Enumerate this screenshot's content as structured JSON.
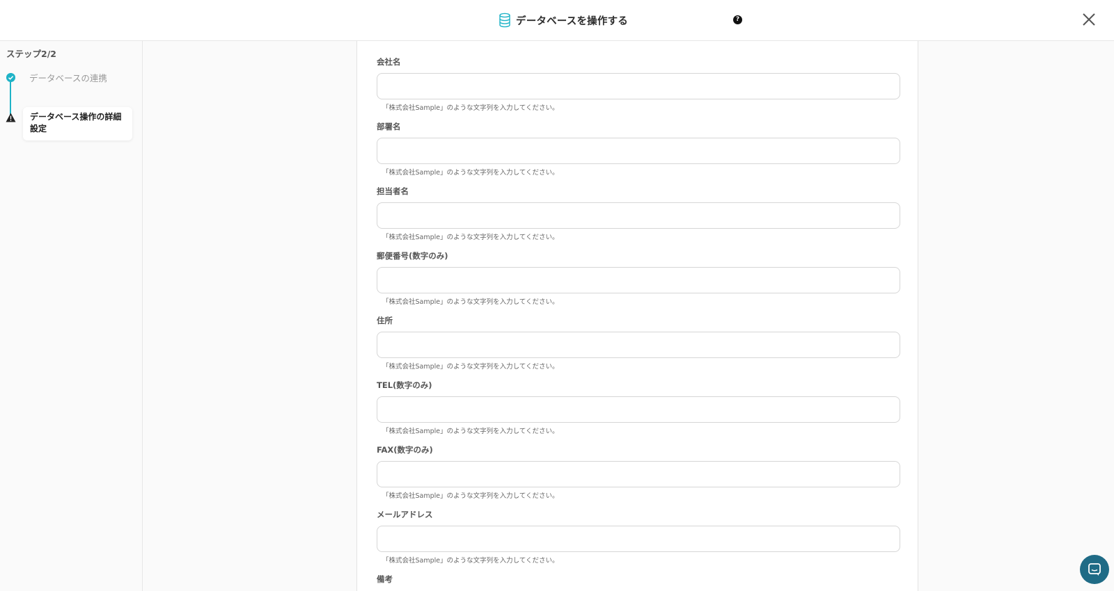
{
  "header": {
    "title": "データベースを操作する",
    "help_icon": "question-circle-icon",
    "close_icon": "close-icon"
  },
  "sidebar": {
    "step_count": "ステップ2/2",
    "steps": [
      {
        "label": "データベースの連携",
        "status": "done",
        "icon": "check-circle-icon"
      },
      {
        "label": "データベース操作の詳細設定",
        "status": "warning",
        "icon": "warning-icon"
      }
    ]
  },
  "form": {
    "fields": [
      {
        "label": "会社名",
        "value": "",
        "hint": "「株式会社Sample」のような文字列を入力してください。"
      },
      {
        "label": "部署名",
        "value": "",
        "hint": "「株式会社Sample」のような文字列を入力してください。"
      },
      {
        "label": "担当者名",
        "value": "",
        "hint": "「株式会社Sample」のような文字列を入力してください。"
      },
      {
        "label": "郵便番号(数字のみ)",
        "value": "",
        "hint": "「株式会社Sample」のような文字列を入力してください。"
      },
      {
        "label": "住所",
        "value": "",
        "hint": "「株式会社Sample」のような文字列を入力してください。"
      },
      {
        "label": "TEL(数字のみ)",
        "value": "",
        "hint": "「株式会社Sample」のような文字列を入力してください。"
      },
      {
        "label": "FAX(数字のみ)",
        "value": "",
        "hint": "「株式会社Sample」のような文字列を入力してください。"
      },
      {
        "label": "メールアドレス",
        "value": "",
        "hint": "「株式会社Sample」のような文字列を入力してください。"
      },
      {
        "label": "備考",
        "value": "",
        "hint": ""
      }
    ]
  },
  "chat": {
    "icon": "chat-bubble-icon"
  },
  "colors": {
    "accent": "#1fb3c7",
    "chat": "#1f6b86"
  }
}
